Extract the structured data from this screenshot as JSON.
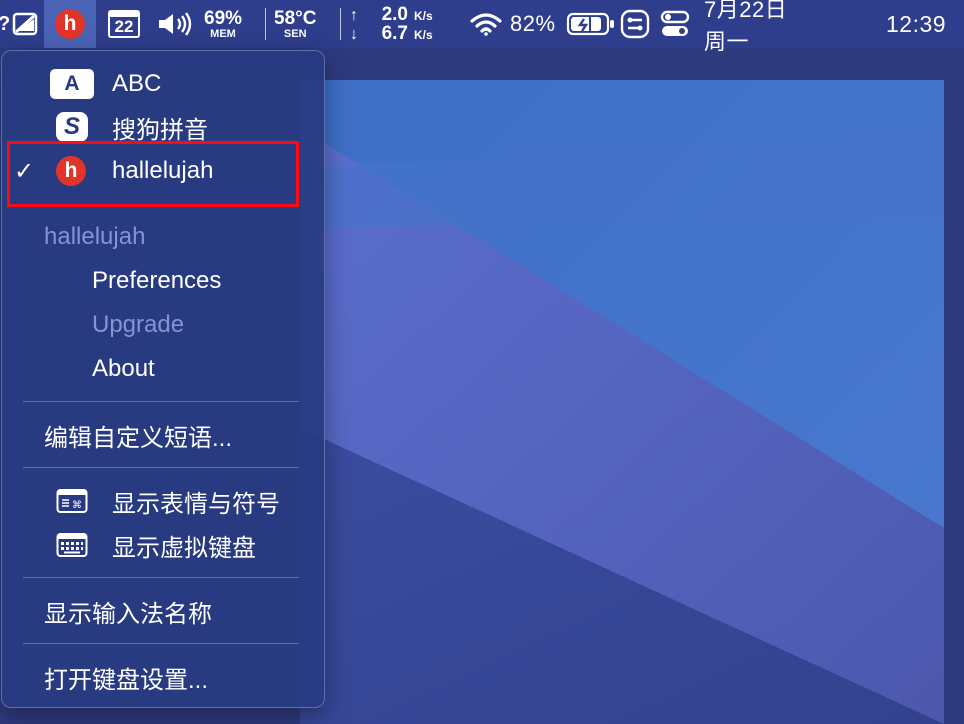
{
  "menubar": {
    "date_label": "7月22日 周一",
    "time_label": "12:39",
    "ime_icon_letter": "h",
    "calendar_day": "22",
    "mem_percent": "69%",
    "mem_label": "MEM",
    "sensor_temp": "58°C",
    "sensor_label": "SEN",
    "net_up_value": "2.0",
    "net_down_value": "6.7",
    "net_unit": "K/s",
    "wifi_battery_percent": "82%",
    "colors": {
      "bar_bg": "#2e3d8c",
      "ime_icon_red": "#e2352a"
    }
  },
  "menu": {
    "input_sources": [
      {
        "icon": "A",
        "label": "ABC",
        "checked": false
      },
      {
        "icon": "S",
        "label": "搜狗拼音",
        "checked": false
      },
      {
        "icon": "h",
        "label": "hallelujah",
        "checked": true
      }
    ],
    "check_mark": "✓",
    "section_title": "hallelujah",
    "section_items": [
      "Preferences",
      "Upgrade",
      "About"
    ],
    "edit_phrases": "编辑自定义短语...",
    "show_emoji": "显示表情与符号",
    "show_keyboard": "显示虚拟键盘",
    "show_ime_name": "显示输入法名称",
    "open_keyboard_settings": "打开键盘设置...",
    "colors": {
      "highlight_border": "#ff0a12",
      "disabled_text": "#8494d4"
    }
  }
}
